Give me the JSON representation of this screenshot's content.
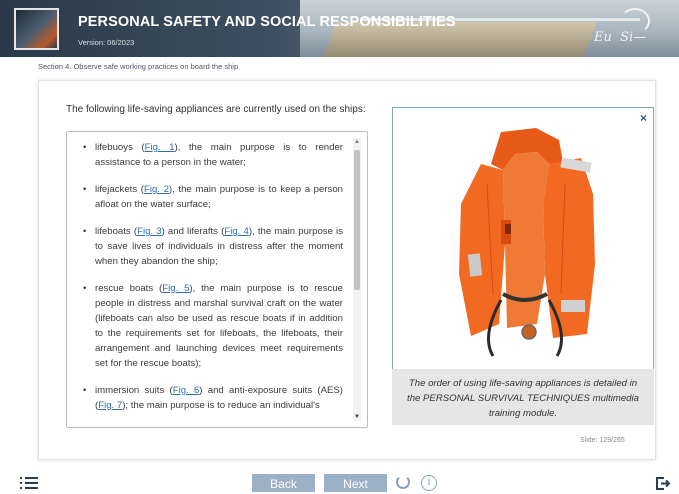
{
  "header": {
    "title": "PERSONAL SAFETY AND SOCIAL RESPONSIBILITIES",
    "version": "Version: 06/2023",
    "brand": "Eu  Si—"
  },
  "section": "Section 4. Observe safe working practices on board the ship",
  "intro": "The following life-saving appliances are currently used on the ships:",
  "items": [
    {
      "before": "lifebuoys (",
      "link": "Fig. 1",
      "after": "), the main purpose is to render assistance to a person in the water;"
    },
    {
      "before": "lifejackets (",
      "link": "Fig. 2",
      "after": "), the main purpose is to keep a person afloat on the water surface;"
    },
    {
      "before": "lifeboats (",
      "link": "Fig. 3",
      "mid": ") and liferafts (",
      "link2": "Fig. 4",
      "after": "), the main purpose is to save lives of individuals in distress after the moment when they abandon the ship;"
    },
    {
      "before": "rescue boats (",
      "link": "Fig. 5",
      "after": "), the main purpose is to rescue people in distress and marshal survival craft on the water (lifeboats can also be used as rescue boats if in addition to the requirements set for lifeboats, the lifeboats, their arrangement and launching devices meet requirements set for the rescue boats);"
    },
    {
      "before": "immersion suits (",
      "link": "Fig. 6",
      "mid": ") and anti-exposure suits (AES) (",
      "link2": "Fig. 7",
      "after": "); the main purpose is to reduce an individual's"
    }
  ],
  "image_panel": {
    "close": "×",
    "caption": "The order of using life-saving appliances is detailed in the PERSONAL SURVIVAL TECHNIQUES multimedia training module."
  },
  "slide": "Slide: 129/265",
  "nav": {
    "back": "Back",
    "next": "Next",
    "info": "i"
  },
  "colors": {
    "header_bg": "#2b3a4a",
    "button": "#9cb0c6",
    "link": "#2a6fb5",
    "vest": "#f26a21"
  }
}
